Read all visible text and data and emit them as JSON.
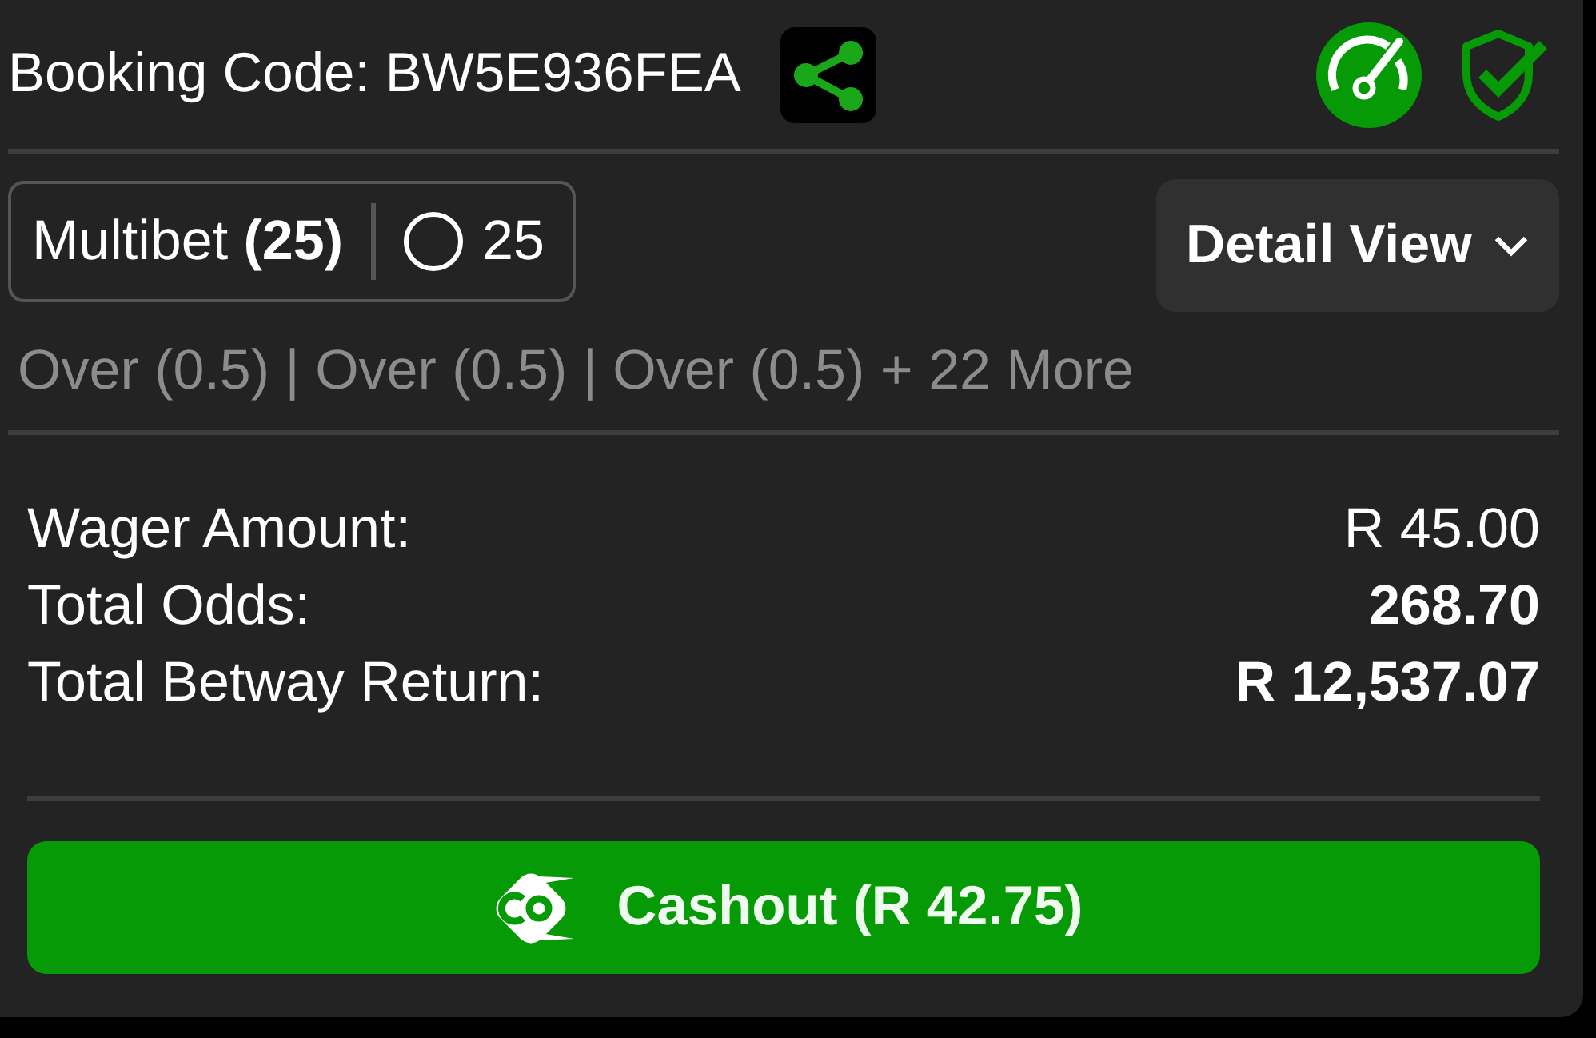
{
  "header": {
    "booking_label": "Booking Code:",
    "booking_code": "BW5E936FEA"
  },
  "bet_type": {
    "label": "Multibet **(25)**",
    "legs": "25"
  },
  "view_menu": {
    "label": "Detail View"
  },
  "selections_summary": "Over (0.5) | Over (0.5) | Over (0.5) + 22 More",
  "summary": [
    {
      "label": "Wager Amount:",
      "value": "R 45.00",
      "bold": false
    },
    {
      "label": "Total Odds:",
      "value": "268.70",
      "bold": true
    },
    {
      "label": "Total Betway Return:",
      "value": "R 12,537.07",
      "bold": true
    }
  ],
  "cashout": {
    "label": "Cashout (R 42.75)"
  }
}
